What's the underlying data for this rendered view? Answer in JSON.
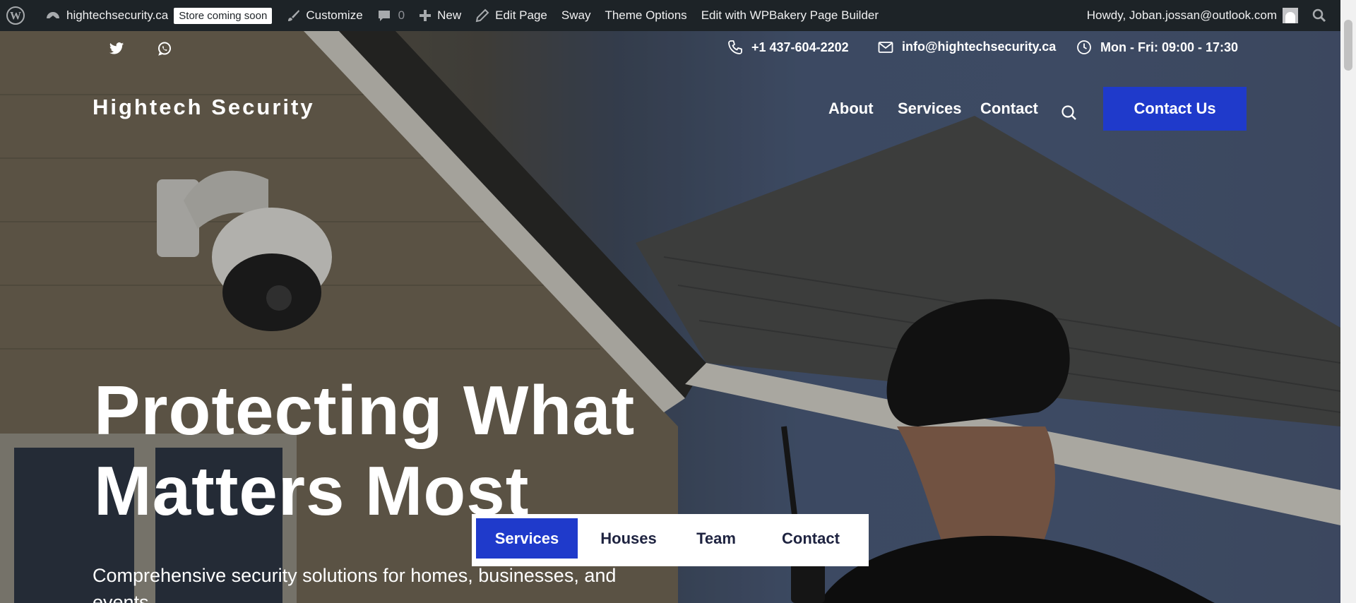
{
  "admin_bar": {
    "site_name": "hightechsecurity.ca",
    "store_badge": "Store coming soon",
    "customize": "Customize",
    "comments_count": "0",
    "new": "New",
    "edit_page": "Edit Page",
    "sway": "Sway",
    "theme_options": "Theme Options",
    "wpbakery": "Edit with WPBakery Page Builder",
    "howdy": "Howdy, Joban.jossan@outlook.com",
    "icons": [
      "wordpress-logo-icon",
      "dashboard-icon",
      "brush-icon",
      "comment-icon",
      "plus-icon",
      "pencil-icon",
      "avatar-icon",
      "search-icon"
    ]
  },
  "topbar": {
    "phone": "+1 437-604-2202",
    "email": "info@hightechsecurity.ca",
    "hours": "Mon - Fri: 09:00 - 17:30",
    "social": [
      "twitter-icon",
      "whatsapp-icon"
    ]
  },
  "header": {
    "brand": "Hightech Security",
    "nav": [
      "About",
      "Services",
      "Contact"
    ],
    "cta": "Contact Us"
  },
  "hero": {
    "headline_line1": "Protecting What",
    "headline_line2": "Matters Most",
    "subheadline": "Comprehensive security solutions for homes, businesses, and events."
  },
  "tabs": {
    "items": [
      "Services",
      "Houses",
      "Team",
      "Contact"
    ],
    "active": "Services"
  },
  "colors": {
    "admin_bar_bg": "#1d2327",
    "accent": "#1f3acb",
    "text_on_dark": "#ffffff"
  }
}
